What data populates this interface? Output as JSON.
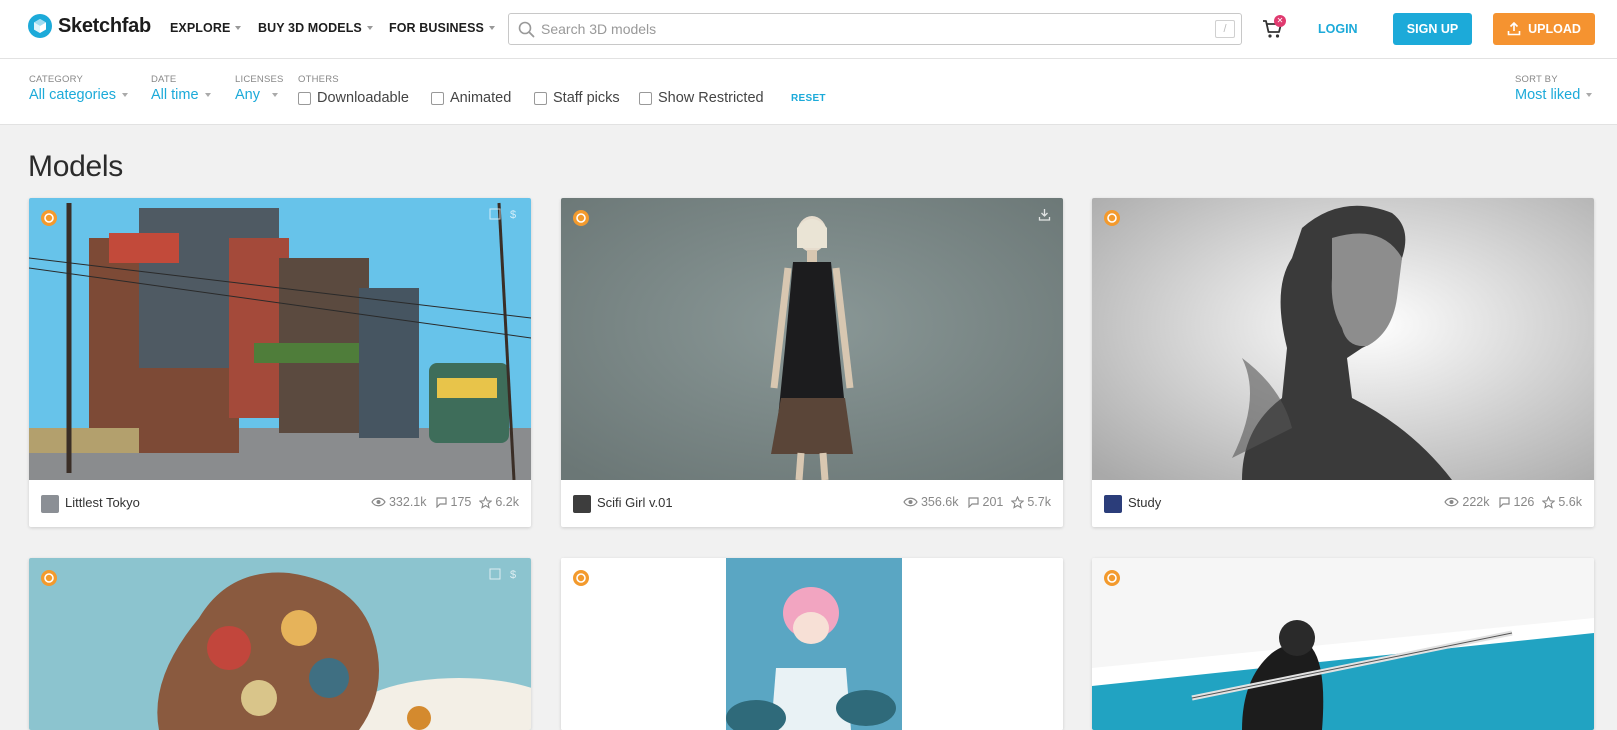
{
  "header": {
    "logo_text": "Sketchfab",
    "nav": [
      {
        "label": "EXPLORE"
      },
      {
        "label": "BUY 3D MODELS"
      },
      {
        "label": "FOR BUSINESS"
      }
    ],
    "search_placeholder": "Search 3D models",
    "search_shortcut": "/",
    "cart_badge": "✕",
    "login_label": "LOGIN",
    "signup_label": "SIGN UP",
    "upload_label": "UPLOAD"
  },
  "filters": {
    "category": {
      "label": "CATEGORY",
      "value": "All categories"
    },
    "date": {
      "label": "DATE",
      "value": "All time"
    },
    "licenses": {
      "label": "LICENSES",
      "value": "Any"
    },
    "others_label": "OTHERS",
    "checkboxes": [
      "Downloadable",
      "Animated",
      "Staff picks",
      "Show Restricted"
    ],
    "reset_label": "RESET",
    "sort": {
      "label": "SORT BY",
      "value": "Most liked"
    }
  },
  "page_title": "Models",
  "models": [
    {
      "name": "Littlest Tokyo",
      "views": "332.1k",
      "comments": "175",
      "likes": "6.2k"
    },
    {
      "name": "Scifi Girl v.01",
      "views": "356.6k",
      "comments": "201",
      "likes": "5.7k"
    },
    {
      "name": "Study",
      "views": "222k",
      "comments": "126",
      "likes": "5.6k"
    }
  ],
  "colors": {
    "accent": "#1caad9",
    "upload": "#f59330",
    "staff_pick": "#f39a2d",
    "badge": "#e03a6f"
  }
}
